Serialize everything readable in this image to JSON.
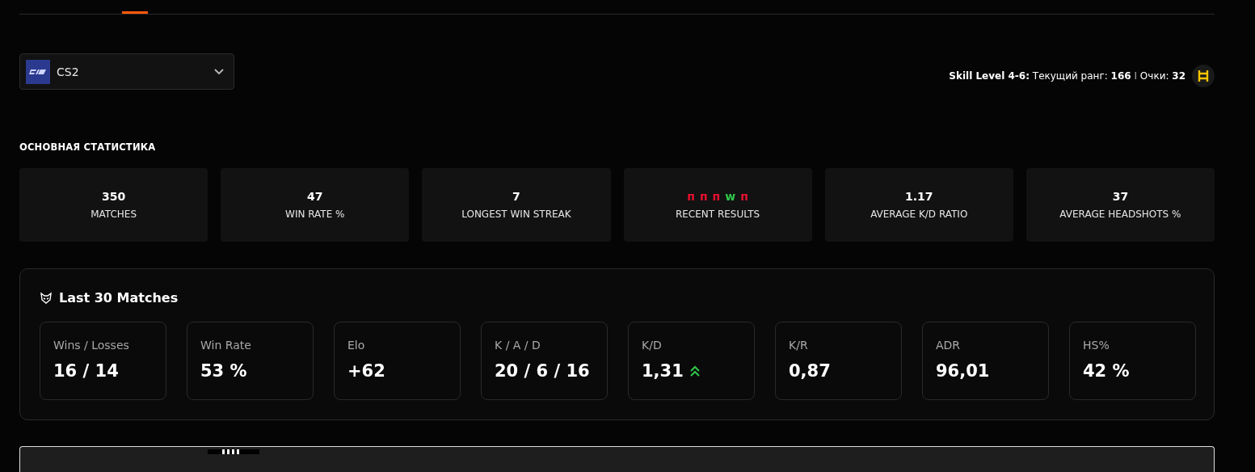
{
  "game_select": {
    "value": "CS2"
  },
  "skill": {
    "label": "Skill Level 4-6:",
    "rank_label": "Текущий ранг:",
    "rank": "166",
    "separator": "I",
    "points_label": "Очки:",
    "points": "32"
  },
  "main_stats": {
    "title": "ОСНОВНАЯ СТАТИСТИКА",
    "cards": [
      {
        "kind": "value",
        "value": "350",
        "label": "MATCHES"
      },
      {
        "kind": "value",
        "value": "47",
        "label": "WIN RATE %"
      },
      {
        "kind": "value",
        "value": "7",
        "label": "LONGEST WIN STREAK"
      },
      {
        "kind": "results",
        "results": [
          {
            "text": "п",
            "color": "#e8102e"
          },
          {
            "text": "п",
            "color": "#e8102e"
          },
          {
            "text": "п",
            "color": "#e8102e"
          },
          {
            "text": "w",
            "color": "#2fc94a"
          },
          {
            "text": "п",
            "color": "#e8102e"
          }
        ],
        "label": "RECENT RESULTS"
      },
      {
        "kind": "value",
        "value": "1.17",
        "label": "AVERAGE K/D RATIO"
      },
      {
        "kind": "value",
        "value": "37",
        "label": "AVERAGE HEADSHOTS %"
      }
    ]
  },
  "last_matches": {
    "title": "Last 30 Matches",
    "stats": [
      {
        "label": "Wins / Losses",
        "value": "16 / 14",
        "trend_up": false
      },
      {
        "label": "Win Rate",
        "value": "53 %",
        "trend_up": false
      },
      {
        "label": "Elo",
        "value": "+62",
        "trend_up": false
      },
      {
        "label": "K / A / D",
        "value": "20 / 6 / 16",
        "trend_up": false
      },
      {
        "label": "K/D",
        "value": "1,31",
        "trend_up": true
      },
      {
        "label": "K/R",
        "value": "0,87",
        "trend_up": false
      },
      {
        "label": "ADR",
        "value": "96,01",
        "trend_up": false
      },
      {
        "label": "HS%",
        "value": "42 %",
        "trend_up": false
      }
    ]
  }
}
